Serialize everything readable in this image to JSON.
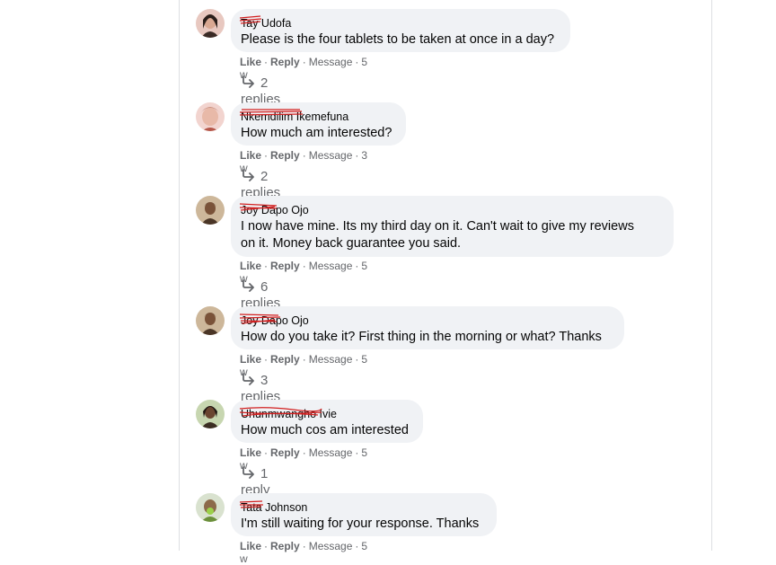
{
  "comments": [
    {
      "author": "Tay Udofa",
      "text_lines": [
        "Please is the four tablets to be taken at once in a day?"
      ],
      "like_label": "Like",
      "reply_label": "Reply",
      "message_label": "Message",
      "time": "5 w",
      "replies": "2 replies",
      "avatar_colors": [
        "#e8c8c0",
        "#3a2a25"
      ]
    },
    {
      "author": "Nkemdilim Ikemefuna",
      "text_lines": [
        "How much am interested?"
      ],
      "like_label": "Like",
      "reply_label": "Reply",
      "message_label": "Message",
      "time": "3 w",
      "replies": "2 replies",
      "avatar_colors": [
        "#f2d4cf",
        "#c98f7f"
      ]
    },
    {
      "author": "Joy Dapo Ojo",
      "text_lines": [
        "I now have mine. Its my third day on it. Can't wait to give my reviews",
        "on it. Money back guarantee you said."
      ],
      "like_label": "Like",
      "reply_label": "Reply",
      "message_label": "Message",
      "time": "5 w",
      "replies": "6 replies",
      "avatar_colors": [
        "#cdb79a",
        "#4a3526"
      ]
    },
    {
      "author": "Joy Dapo Ojo",
      "text_lines": [
        "How do you take it? First thing in the morning or what? Thanks"
      ],
      "like_label": "Like",
      "reply_label": "Reply",
      "message_label": "Message",
      "time": "5 w",
      "replies": "3 replies",
      "avatar_colors": [
        "#cdb79a",
        "#4a3526"
      ]
    },
    {
      "author": "Uhunmwangho Ivie",
      "text_lines": [
        "How much cos am interested"
      ],
      "like_label": "Like",
      "reply_label": "Reply",
      "message_label": "Message",
      "time": "5 w",
      "replies": "1 reply",
      "avatar_colors": [
        "#c7d6b0",
        "#3b2d22"
      ]
    },
    {
      "author": "Tata Johnson",
      "text_lines": [
        "I'm still waiting for your response. Thanks"
      ],
      "like_label": "Like",
      "reply_label": "Reply",
      "message_label": "Message",
      "time": "5 w",
      "replies": "",
      "avatar_colors": [
        "#d9e2cf",
        "#6b8f3a"
      ]
    }
  ],
  "colors": {
    "bubble": "#f0f2f5",
    "meta_text": "#65676b",
    "redaction": "#d21f1f"
  }
}
